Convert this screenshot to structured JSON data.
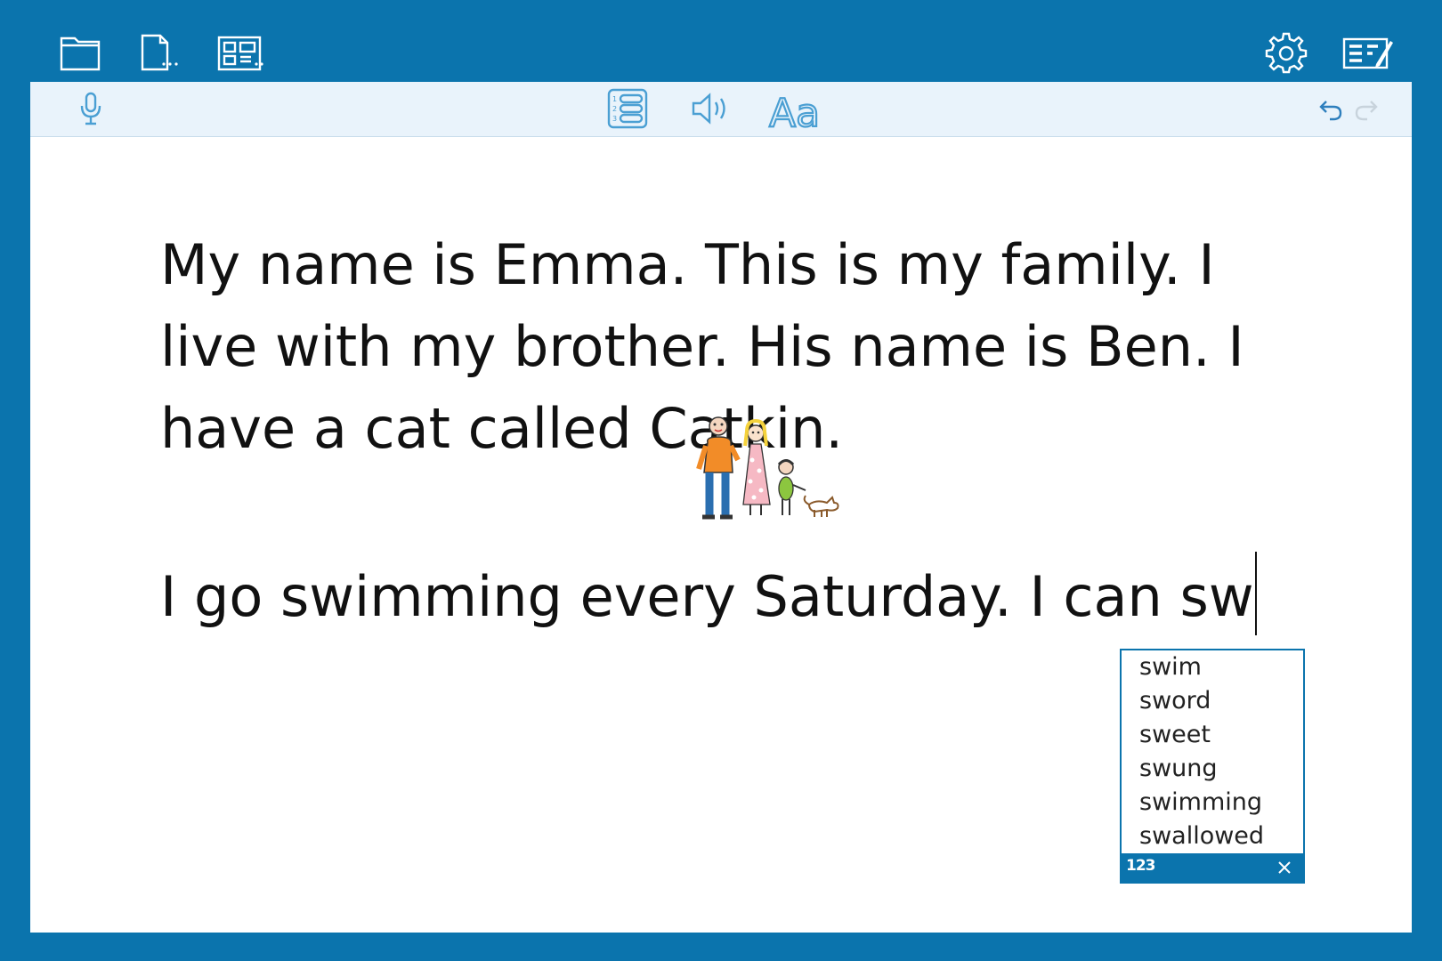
{
  "topbar": {
    "icons": [
      "folder-icon",
      "document-more-icon",
      "layout-grid-icon",
      "gear-icon",
      "write-panel-icon"
    ]
  },
  "toolbar2": {
    "icons": [
      "microphone-icon",
      "numbered-list-icon",
      "speaker-icon",
      "font-icon",
      "undo-icon",
      "redo-icon"
    ],
    "font_label": "Aa",
    "list_numbers": [
      "1",
      "2",
      "3"
    ]
  },
  "document": {
    "paragraph1": "My name is Emma. This is my family. I live with my brother. His name is Ben. I have a cat called Catkin.",
    "paragraph2": "I go swimming every Saturday. I can sw"
  },
  "suggestions": {
    "items": [
      "swim",
      "sword",
      "sweet",
      "swung",
      "swimming",
      "swallowed"
    ],
    "footer_numbers": "123"
  },
  "colors": {
    "frame": "#0b74ad",
    "toolbar": "#e9f3fb",
    "icon_light": "#4a9fd3",
    "page": "#ffffff"
  }
}
